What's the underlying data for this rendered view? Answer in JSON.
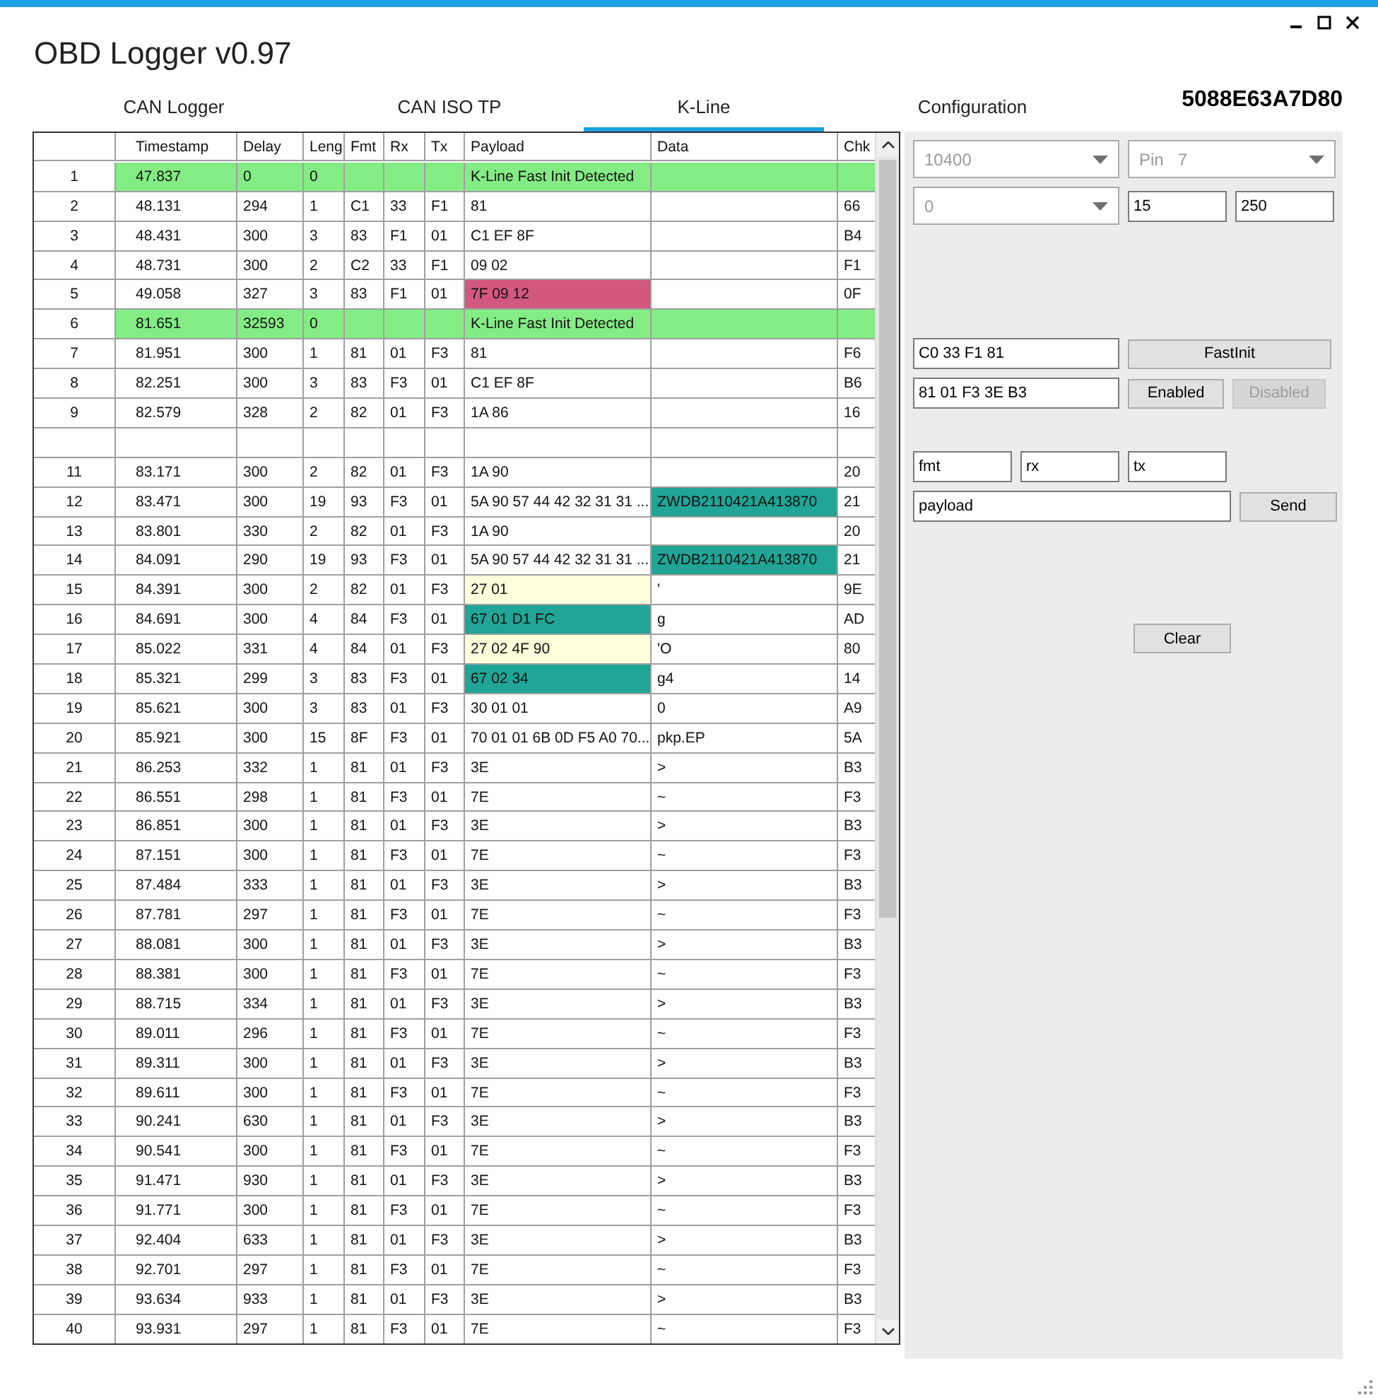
{
  "window": {
    "title": "OBD Logger v0.97",
    "device_id": "5088E63A7D80"
  },
  "tabs": [
    {
      "label": "CAN Logger",
      "selected": false
    },
    {
      "label": "CAN ISO TP",
      "selected": false
    },
    {
      "label": "K-Line",
      "selected": true
    },
    {
      "label": "Configuration",
      "selected": false
    }
  ],
  "table": {
    "columns": [
      "Timestamp",
      "Delay",
      "Leng",
      "Fmt",
      "Rx",
      "Tx",
      "Payload",
      "Data",
      "Chk"
    ],
    "rows": [
      {
        "n": "1",
        "cells": [
          "47.837",
          "0",
          "0",
          "",
          "",
          "",
          "K-Line Fast Init Detected",
          "",
          ""
        ],
        "color": "#84ec84"
      },
      {
        "n": "2",
        "cells": [
          "48.131",
          "294",
          "1",
          "C1",
          "33",
          "F1",
          "81",
          "",
          "66"
        ]
      },
      {
        "n": "3",
        "cells": [
          "48.431",
          "300",
          "3",
          "83",
          "F1",
          "01",
          "C1 EF 8F",
          "",
          "B4"
        ]
      },
      {
        "n": "4",
        "cells": [
          "48.731",
          "300",
          "2",
          "C2",
          "33",
          "F1",
          "09 02",
          "",
          "F1"
        ]
      },
      {
        "n": "5",
        "cells": [
          "49.058",
          "327",
          "3",
          "83",
          "F1",
          "01",
          {
            "text": "7F 09 12",
            "color": "#d2587e"
          },
          "",
          "0F"
        ]
      },
      {
        "n": "6",
        "cells": [
          "81.651",
          "32593",
          "0",
          "",
          "",
          "",
          "K-Line Fast Init Detected",
          "",
          ""
        ],
        "color": "#84ec84"
      },
      {
        "n": "7",
        "cells": [
          "81.951",
          "300",
          "1",
          "81",
          "01",
          "F3",
          "81",
          "",
          "F6"
        ]
      },
      {
        "n": "8",
        "cells": [
          "82.251",
          "300",
          "3",
          "83",
          "F3",
          "01",
          "C1 EF 8F",
          "",
          "B6"
        ]
      },
      {
        "n": "9",
        "cells": [
          "82.579",
          "328",
          "2",
          "82",
          "01",
          "F3",
          "1A 86",
          "",
          "16"
        ]
      },
      {
        "n": "",
        "cells": [
          "",
          "",
          "",
          "",
          "",
          "",
          "",
          "",
          ""
        ]
      },
      {
        "n": "11",
        "cells": [
          "83.171",
          "300",
          "2",
          "82",
          "01",
          "F3",
          "1A 90",
          "",
          "20"
        ]
      },
      {
        "n": "12",
        "cells": [
          "83.471",
          "300",
          "19",
          "93",
          "F3",
          "01",
          "5A 90 57 44 42 32 31 31 ...",
          {
            "text": "ZWDB2110421A413870",
            "color": "#20a596"
          },
          "21"
        ]
      },
      {
        "n": "13",
        "cells": [
          "83.801",
          "330",
          "2",
          "82",
          "01",
          "F3",
          "1A 90",
          "",
          "20"
        ]
      },
      {
        "n": "14",
        "cells": [
          "84.091",
          "290",
          "19",
          "93",
          "F3",
          "01",
          "5A 90 57 44 42 32 31 31 ...",
          {
            "text": "ZWDB2110421A413870",
            "color": "#20a596"
          },
          "21"
        ]
      },
      {
        "n": "15",
        "cells": [
          "84.391",
          "300",
          "2",
          "82",
          "01",
          "F3",
          {
            "text": "27 01",
            "color": "#ffffdc"
          },
          "'",
          "9E"
        ]
      },
      {
        "n": "16",
        "cells": [
          "84.691",
          "300",
          "4",
          "84",
          "F3",
          "01",
          {
            "text": "67 01 D1 FC",
            "color": "#20a596"
          },
          "g",
          "AD"
        ]
      },
      {
        "n": "17",
        "cells": [
          "85.022",
          "331",
          "4",
          "84",
          "01",
          "F3",
          {
            "text": "27 02 4F 90",
            "color": "#ffffdc"
          },
          "'O",
          "80"
        ]
      },
      {
        "n": "18",
        "cells": [
          "85.321",
          "299",
          "3",
          "83",
          "F3",
          "01",
          {
            "text": "67 02 34",
            "color": "#20a596"
          },
          "g4",
          "14"
        ]
      },
      {
        "n": "19",
        "cells": [
          "85.621",
          "300",
          "3",
          "83",
          "01",
          "F3",
          "30 01 01",
          "0",
          "A9"
        ]
      },
      {
        "n": "20",
        "cells": [
          "85.921",
          "300",
          "15",
          "8F",
          "F3",
          "01",
          "70 01 01 6B 0D F5 A0 70...",
          "pkp.EP",
          "5A"
        ]
      },
      {
        "n": "21",
        "cells": [
          "86.253",
          "332",
          "1",
          "81",
          "01",
          "F3",
          "3E",
          ">",
          "B3"
        ]
      },
      {
        "n": "22",
        "cells": [
          "86.551",
          "298",
          "1",
          "81",
          "F3",
          "01",
          "7E",
          "~",
          "F3"
        ]
      },
      {
        "n": "23",
        "cells": [
          "86.851",
          "300",
          "1",
          "81",
          "01",
          "F3",
          "3E",
          ">",
          "B3"
        ]
      },
      {
        "n": "24",
        "cells": [
          "87.151",
          "300",
          "1",
          "81",
          "F3",
          "01",
          "7E",
          "~",
          "F3"
        ]
      },
      {
        "n": "25",
        "cells": [
          "87.484",
          "333",
          "1",
          "81",
          "01",
          "F3",
          "3E",
          ">",
          "B3"
        ]
      },
      {
        "n": "26",
        "cells": [
          "87.781",
          "297",
          "1",
          "81",
          "F3",
          "01",
          "7E",
          "~",
          "F3"
        ]
      },
      {
        "n": "27",
        "cells": [
          "88.081",
          "300",
          "1",
          "81",
          "01",
          "F3",
          "3E",
          ">",
          "B3"
        ]
      },
      {
        "n": "28",
        "cells": [
          "88.381",
          "300",
          "1",
          "81",
          "F3",
          "01",
          "7E",
          "~",
          "F3"
        ]
      },
      {
        "n": "29",
        "cells": [
          "88.715",
          "334",
          "1",
          "81",
          "01",
          "F3",
          "3E",
          ">",
          "B3"
        ]
      },
      {
        "n": "30",
        "cells": [
          "89.011",
          "296",
          "1",
          "81",
          "F3",
          "01",
          "7E",
          "~",
          "F3"
        ]
      },
      {
        "n": "31",
        "cells": [
          "89.311",
          "300",
          "1",
          "81",
          "01",
          "F3",
          "3E",
          ">",
          "B3"
        ]
      },
      {
        "n": "32",
        "cells": [
          "89.611",
          "300",
          "1",
          "81",
          "F3",
          "01",
          "7E",
          "~",
          "F3"
        ]
      },
      {
        "n": "33",
        "cells": [
          "90.241",
          "630",
          "1",
          "81",
          "01",
          "F3",
          "3E",
          ">",
          "B3"
        ]
      },
      {
        "n": "34",
        "cells": [
          "90.541",
          "300",
          "1",
          "81",
          "F3",
          "01",
          "7E",
          "~",
          "F3"
        ]
      },
      {
        "n": "35",
        "cells": [
          "91.471",
          "930",
          "1",
          "81",
          "01",
          "F3",
          "3E",
          ">",
          "B3"
        ]
      },
      {
        "n": "36",
        "cells": [
          "91.771",
          "300",
          "1",
          "81",
          "F3",
          "01",
          "7E",
          "~",
          "F3"
        ]
      },
      {
        "n": "37",
        "cells": [
          "92.404",
          "633",
          "1",
          "81",
          "01",
          "F3",
          "3E",
          ">",
          "B3"
        ]
      },
      {
        "n": "38",
        "cells": [
          "92.701",
          "297",
          "1",
          "81",
          "F3",
          "01",
          "7E",
          "~",
          "F3"
        ]
      },
      {
        "n": "39",
        "cells": [
          "93.634",
          "933",
          "1",
          "81",
          "01",
          "F3",
          "3E",
          ">",
          "B3"
        ]
      },
      {
        "n": "40",
        "cells": [
          "93.931",
          "297",
          "1",
          "81",
          "F3",
          "01",
          "7E",
          "~",
          "F3"
        ]
      }
    ]
  },
  "panel": {
    "baud_select": {
      "value": "10400",
      "disabled": true
    },
    "pin_select": {
      "value": "Pin   7",
      "disabled": true
    },
    "mode_select": {
      "value": "0",
      "disabled": true
    },
    "field_a": "15",
    "field_b": "250",
    "init_message": "C0 33 F1 81",
    "fastinit_button": {
      "label": "FastInit",
      "disabled": false
    },
    "keepalive_message": "81 01 F3 3E B3",
    "enabled_button": {
      "label": "Enabled",
      "disabled": false
    },
    "disabled_button": {
      "label": "Disabled",
      "disabled": true
    },
    "fmt": "fmt",
    "rx": "rx",
    "tx": "tx",
    "payload": "payload",
    "send_button": {
      "label": "Send",
      "disabled": false
    },
    "clear_button": {
      "label": "Clear",
      "disabled": false
    }
  }
}
